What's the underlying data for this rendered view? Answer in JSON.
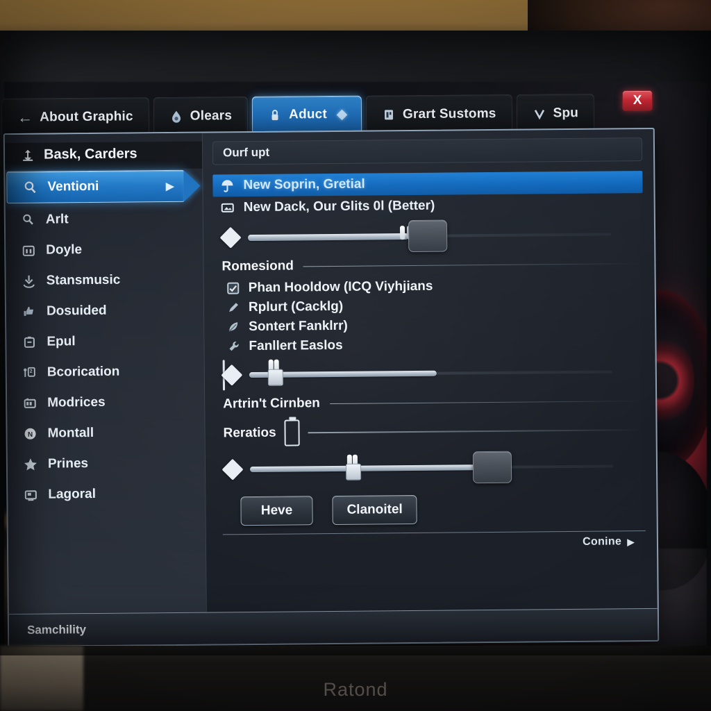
{
  "window": {
    "close_label": "X",
    "status_text": "Samchility",
    "stand_text": "Ratond"
  },
  "tabs": [
    {
      "label": "About Graphic",
      "icon": "back-arrow-icon",
      "active": false,
      "has_back_arrow": true
    },
    {
      "label": "Olears",
      "icon": "droplet-icon",
      "active": false
    },
    {
      "label": "Aduct",
      "icon": "lock-icon",
      "active": true,
      "trailing": "diamond-icon"
    },
    {
      "label": "Grart Sustoms",
      "icon": "book-icon",
      "active": false
    },
    {
      "label": "Spu",
      "icon": "chevron-v-icon",
      "active": false
    }
  ],
  "sidebar": {
    "header": {
      "label": "Bask, Carders",
      "icon": "anchor-icon"
    },
    "items": [
      {
        "label": "Ventioni",
        "icon": "search-icon",
        "selected": true,
        "caret": "▶"
      },
      {
        "label": "Arlt",
        "icon": "magnifier-icon",
        "selected": false
      },
      {
        "label": "Doyle",
        "icon": "calendar-icon",
        "selected": false
      },
      {
        "label": "Stansmusic",
        "icon": "download-icon",
        "selected": false
      },
      {
        "label": "Dosuided",
        "icon": "thumbs-up-icon",
        "selected": false
      },
      {
        "label": "Epul",
        "icon": "clipboard-icon",
        "selected": false
      },
      {
        "label": "Bcorication",
        "icon": "key-card-icon",
        "selected": false
      },
      {
        "label": "Modrices",
        "icon": "battery-icon",
        "selected": false
      },
      {
        "label": "Montall",
        "icon": "circle-badge-icon",
        "selected": false
      },
      {
        "label": "Prines",
        "icon": "star-icon",
        "selected": false
      },
      {
        "label": "Lagoral",
        "icon": "screen-icon",
        "selected": false
      }
    ]
  },
  "content": {
    "search": {
      "value": "Ourf upt",
      "placeholder": "Ourf upt"
    },
    "options": [
      {
        "label": "New Soprin, Gretial",
        "icon": "umbrella-icon",
        "active": true
      },
      {
        "label": "New Dack, Our Glits 0l (Better)",
        "icon": "image-icon",
        "active": false
      }
    ],
    "slider_top": {
      "value_percent": 41,
      "thumb_percent": 41
    },
    "section_1": {
      "label": "Romesiond"
    },
    "checks": [
      {
        "label": "Phan Hooldow (ICQ Viyhjians",
        "icon": "checkbox-checked-icon"
      },
      {
        "label": "Rplurt (Cacklg)",
        "icon": "pen-icon"
      },
      {
        "label": "Sontert Fanklrr)",
        "icon": "feather-icon"
      },
      {
        "label": "Fanllert Easlos",
        "icon": "wrench-icon"
      }
    ],
    "slider_mid": {
      "value_percent": 48,
      "thumb_percent": 6
    },
    "section_2": {
      "label": "Artrin't Cirnben"
    },
    "ratios": {
      "label": "Reratios",
      "icon": "battery-icon"
    },
    "slider_bottom": {
      "value_percent": 73,
      "thumb_percent": 26
    },
    "buttons": [
      {
        "label": "Heve",
        "name": "apply-button"
      },
      {
        "label": "Clanoitel",
        "name": "cancel-button"
      }
    ],
    "continue": {
      "label": "Conine",
      "arrow": "▶"
    }
  },
  "colors": {
    "accent_blue": "#1f7fd4",
    "tab_active": "#2f7fc4",
    "close_red": "#c22733",
    "panel_bg": "#20252e",
    "border_light": "#8fa3b8"
  }
}
